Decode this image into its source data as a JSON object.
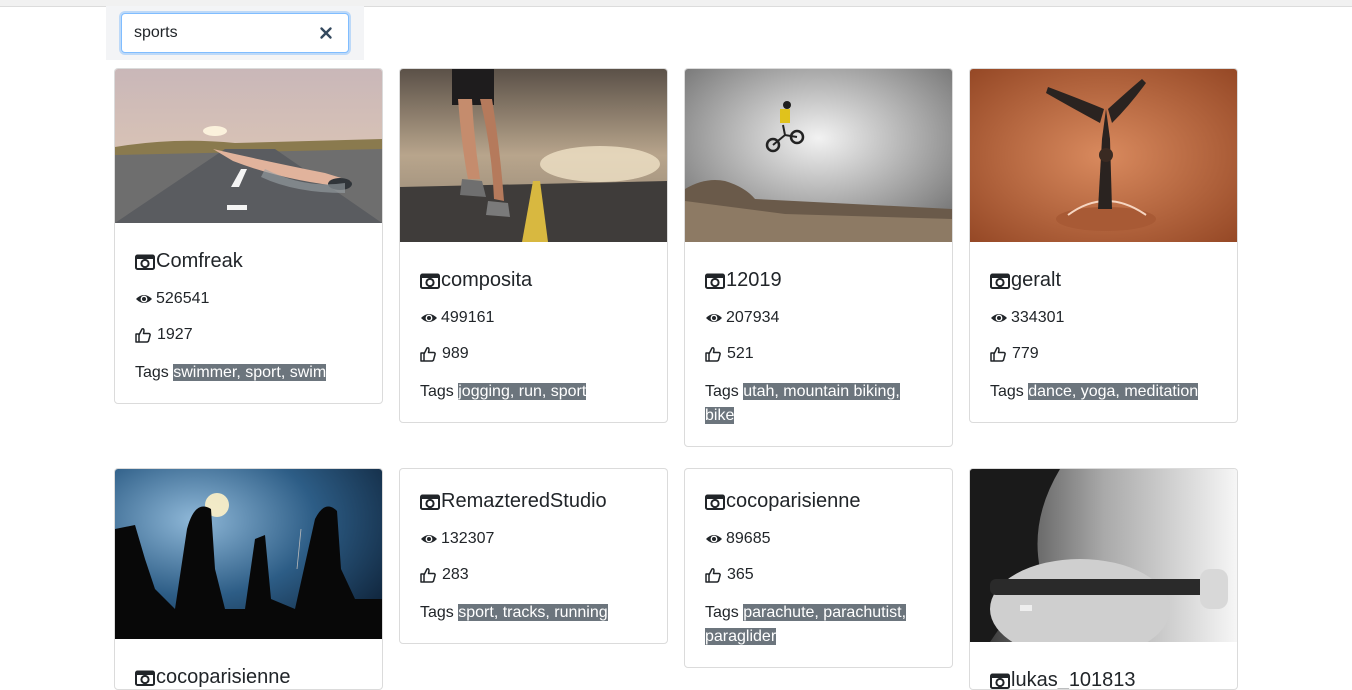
{
  "search": {
    "value": "sports",
    "clear_icon": "close-icon"
  },
  "tags_label": "Tags",
  "cards": [
    {
      "author": "Comfreak",
      "views": "526541",
      "likes": "1927",
      "tags": "swimmer, sport, swim"
    },
    {
      "author": "composita",
      "views": "499161",
      "likes": "989",
      "tags": "jogging, run, sport"
    },
    {
      "author": "12019",
      "views": "207934",
      "likes": "521",
      "tags": "utah, mountain biking, bike"
    },
    {
      "author": "geralt",
      "views": "334301",
      "likes": "779",
      "tags": "dance, yoga, meditation"
    },
    {
      "author": "cocoparisienne"
    },
    {
      "author": "RemazteredStudio",
      "views": "132307",
      "likes": "283",
      "tags": "sport, tracks, running"
    },
    {
      "author": "cocoparisienne",
      "views": "89685",
      "likes": "365",
      "tags": "parachute, parachutist, paraglider"
    },
    {
      "author": "lukas_101813"
    }
  ],
  "icons": {
    "camera": "camera-icon",
    "views": "eye-icon",
    "likes": "thumbs-up-icon"
  }
}
